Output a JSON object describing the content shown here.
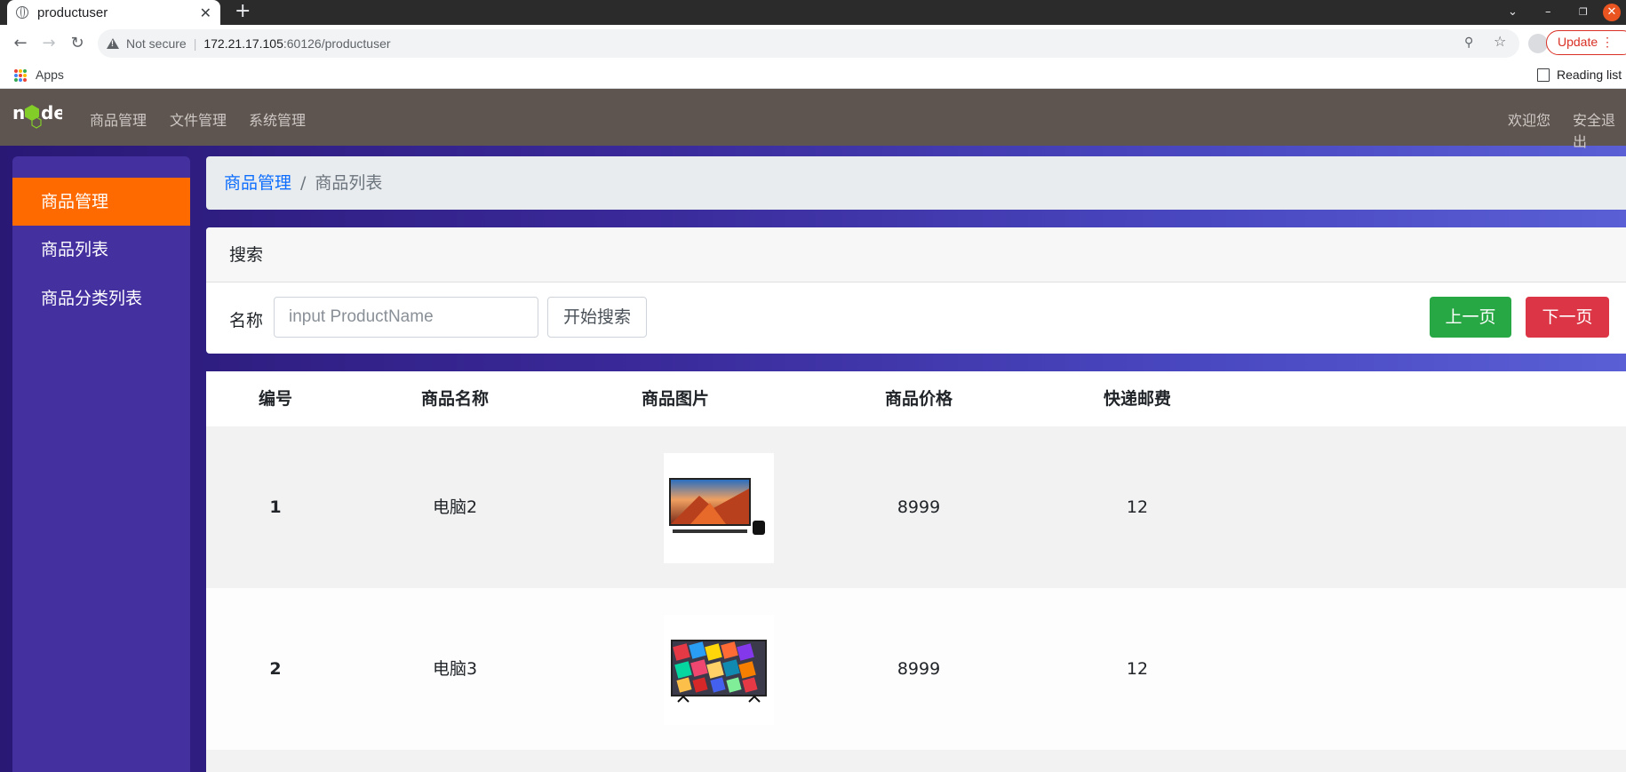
{
  "browser": {
    "tab_title": "productuser",
    "tab_close": "✕",
    "new_tab": "+",
    "security_label": "Not secure",
    "url_host": "172.21.17.105",
    "url_rest": ":60126/productuser",
    "update_label": "Update",
    "bookmarks_apps": "Apps",
    "reading_list": "Reading list"
  },
  "app": {
    "nav": {
      "items": [
        "商品管理",
        "文件管理",
        "系统管理"
      ],
      "welcome": "欢迎您",
      "logout": "安全退出"
    },
    "sidebar": {
      "items": [
        {
          "label": "商品管理",
          "active": true
        },
        {
          "label": "商品列表",
          "active": false
        },
        {
          "label": "商品分类列表",
          "active": false
        }
      ]
    },
    "breadcrumb": {
      "parent": "商品管理",
      "separator": "/",
      "current": "商品列表"
    },
    "search": {
      "header": "搜索",
      "label": "名称",
      "placeholder": "input ProductName",
      "value": "",
      "search_button": "开始搜索",
      "prev_button": "上一页",
      "next_button": "下一页"
    },
    "table": {
      "columns": [
        "编号",
        "商品名称",
        "商品图片",
        "商品价格",
        "快递邮费"
      ],
      "rows": [
        {
          "id": "1",
          "name": "电脑2",
          "image": "tv-landscape-image",
          "price": "8999",
          "shipping": "12"
        },
        {
          "id": "2",
          "name": "电脑3",
          "image": "tv-colorful-cubes-image",
          "price": "8999",
          "shipping": "12"
        }
      ]
    },
    "colors": {
      "nav_bg": "#5e5450",
      "sidebar_active": "#ff6a00",
      "prev_button": "#28a745",
      "next_button": "#dc3545",
      "link": "#0d6efd"
    }
  }
}
